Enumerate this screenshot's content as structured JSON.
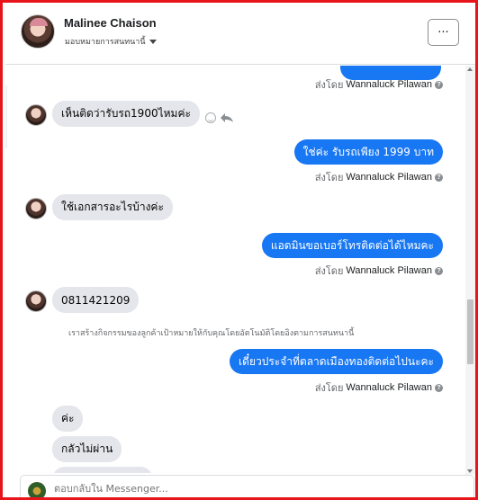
{
  "header": {
    "contact_name": "Malinee Chaison",
    "assign_label": "มอบหมายการสนทนานี้",
    "more_label": "···"
  },
  "messages": [
    {
      "dir": "out",
      "text": "",
      "partial": true
    },
    {
      "dir": "meta",
      "prefix": "ส่งโดย",
      "agent": "Wannaluck Pilawan"
    },
    {
      "dir": "in",
      "text": "เห็นติดว่ารับรถ1900ไหมค่ะ"
    },
    {
      "dir": "out",
      "text": "ใช่ค่ะ  รับรถเพียง 1999 บาท"
    },
    {
      "dir": "meta",
      "prefix": "ส่งโดย",
      "agent": "Wannaluck Pilawan"
    },
    {
      "dir": "in",
      "text": "ใช้เอกสารอะไรบ้างค่ะ"
    },
    {
      "dir": "out",
      "text": "แอดมินขอเบอร์โทรติดต่อได้ไหมคะ"
    },
    {
      "dir": "meta",
      "prefix": "ส่งโดย",
      "agent": "Wannaluck Pilawan"
    },
    {
      "dir": "in",
      "text": "0811421209"
    },
    {
      "dir": "system",
      "text": "เราสร้างกิจกรรมของลูกค้าเป้าหมายให้กับคุณโดยอัตโนมัติโดยอิงตามการสนทนานี้"
    },
    {
      "dir": "out",
      "text": "เดี๋ยวประจำที่ตลาดเมืองทองติดต่อไปนะคะ"
    },
    {
      "dir": "meta",
      "prefix": "ส่งโดย",
      "agent": "Wannaluck Pilawan"
    },
    {
      "dir": "in",
      "text": "ค่ะ"
    },
    {
      "dir": "in",
      "text": "กลัวไม่ผ่าน"
    }
  ],
  "help_mark": "?",
  "composer": {
    "placeholder": "ตอบกลับใน Messenger..."
  },
  "colors": {
    "outgoing_bubble": "#1877f2",
    "incoming_bubble": "#e4e6eb",
    "frame_border": "#e8141c"
  },
  "icons": [
    "more-icon",
    "caret-down-icon",
    "smile-icon",
    "reply-icon",
    "help-icon"
  ]
}
